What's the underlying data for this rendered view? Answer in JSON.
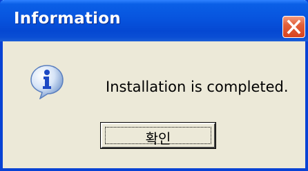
{
  "dialog": {
    "title": "Information",
    "message": "Installation is completed.",
    "ok_label": "확인"
  },
  "icons": {
    "close": "close-icon",
    "info": "information-icon"
  },
  "colors": {
    "titlebar": "#0754de",
    "close_button": "#d8431f",
    "background": "#ece9d8"
  }
}
